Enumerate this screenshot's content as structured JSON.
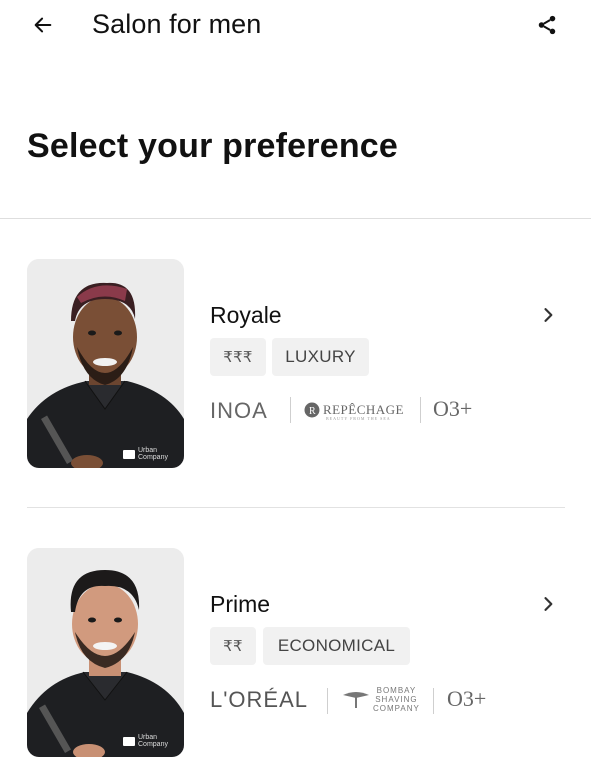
{
  "header": {
    "title": "Salon for men",
    "back_icon": "arrow-left-icon",
    "share_icon": "share-icon"
  },
  "heading": "Select your preference",
  "tiers": [
    {
      "name": "Royale",
      "price_tag": "₹₹₹",
      "category_tag": "LUXURY",
      "brands": [
        "INOA",
        "REPÊCHAGE",
        "BEAUTY FROM THE SEA",
        "O3+"
      ],
      "photo_badge": [
        "Urban",
        "Company"
      ]
    },
    {
      "name": "Prime",
      "price_tag": "₹₹",
      "category_tag": "ECONOMICAL",
      "brands": [
        "L'ORÉAL",
        "BOMBAY",
        "SHAVING",
        "COMPANY",
        "O3+"
      ],
      "photo_badge": [
        "Urban",
        "Company"
      ]
    }
  ],
  "colors": {
    "text": "#111111",
    "tag_bg": "#f1f1f1",
    "divider": "#dedede",
    "photo_bg": "#ececec"
  }
}
